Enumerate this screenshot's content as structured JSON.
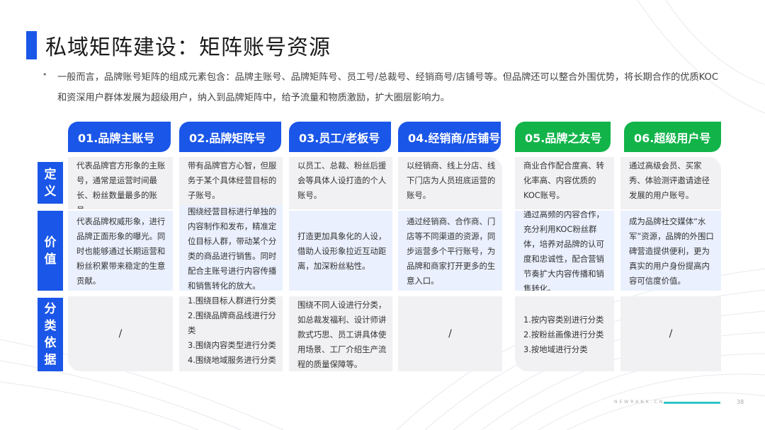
{
  "title": "私域矩阵建设：矩阵账号资源",
  "bullet": "•",
  "intro": "一般而言，品牌账号矩阵的组成元素包含：品牌主账号、品牌矩阵号、员工号/总裁号、经销商号/店铺号等。但品牌还可以整合外围优势，将长期合作的优质KOC和资深用户群体发展为超级用户，纳入到品牌矩阵中，给予流量和物质激励，扩大圈层影响力。",
  "columns": [
    {
      "header": "01.品牌主账号",
      "color": "blue",
      "definition": "代表品牌官方形象的主账号，通常是运营时间最长、粉丝数量最多的账号。",
      "value": "代表品牌权威形象，进行品牌正面形象的曝光。同时也能够通过长期运营和粉丝积累带来稳定的生意贡献。",
      "basis": "/"
    },
    {
      "header": "02.品牌矩阵号",
      "color": "blue",
      "definition": "带有品牌官方心智，但服务于某个具体经营目标的子账号。",
      "value": "围绕经营目标进行单独的内容制作和发布，精准定位目标人群，带动某个分类的商品进行销售。同时配合主账号进行内容传播和销售转化的放大。",
      "basis": [
        "1.围绕目标人群进行分类",
        "2.围绕品牌商品线进行分类",
        "3.围绕内容类型进行分类",
        "4.围绕地域服务进行分类",
        "…"
      ]
    },
    {
      "header": "03.员工/老板号",
      "color": "blue",
      "definition": "以员工、总裁、粉丝后援会等具体人设打造的个人账号。",
      "value": "打造更加具象化的人设，借助人设形象拉近互动距离，加深粉丝粘性。",
      "basis": "围绕不同人设进行分类，如总裁发福利、设计师讲款式巧思、员工讲具体使用场景、工厂介绍生产流程的质量保障等。"
    },
    {
      "header": "04.经销商/店铺号",
      "color": "blue",
      "definition": "以经销商、线上分店、线下门店为人员班底运营的账号。",
      "value": "通过经销商、合作商、门店等不同渠道的资源，同步运营多个平行账号，为品牌和商家打开更多的生意入口。",
      "basis": "/"
    },
    {
      "header": "05.品牌之友号",
      "color": "green",
      "definition": "商业合作配合度高、转化率高、内容优质的KOC账号。",
      "value": "通过高频的内容合作，充分利用KOC粉丝群体，培养对品牌的认可度和忠诚性，配合营销节奏扩大内容传播和销售转化。",
      "basis": [
        "1.按内容类别进行分类",
        "2.按粉丝画像进行分类",
        "3.按地域进行分类"
      ]
    },
    {
      "header": "06.超级用户号",
      "color": "green",
      "definition": "通过高级会员、买家秀、体验测评邀请途径发展的用户账号。",
      "value": "成为品牌社交媒体“水军”资源，品牌的外围口碑营造提供便利，更为真实的用户身份提高内容可信度价值。",
      "basis": "/"
    }
  ],
  "row_labels": {
    "definition": [
      "定",
      "义"
    ],
    "value": [
      "价",
      "值"
    ],
    "basis": [
      "分",
      "类",
      "依",
      "据"
    ]
  },
  "footer": {
    "brand": "NEWRANK.CN",
    "page": "38"
  },
  "colors": {
    "blue": "#1a56e8",
    "green": "#12b44a",
    "teal": "#2ec6c8"
  }
}
